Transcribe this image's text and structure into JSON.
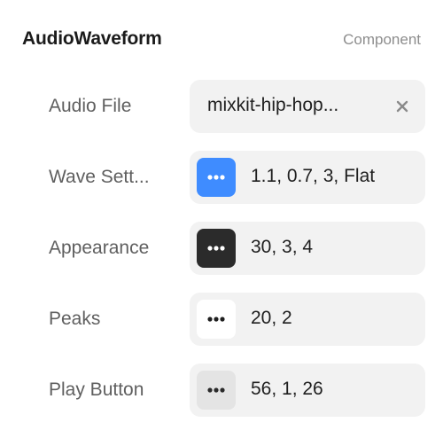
{
  "component": {
    "title": "AudioWaveform",
    "kind_label": "Component"
  },
  "properties": [
    {
      "label": "Audio File",
      "value": "mixkit-hip-hop...",
      "icon": "clear-icon"
    },
    {
      "label": "Wave Sett...",
      "value": "1.1, 0.7, 3, Flat",
      "icon": "more-dots-icon",
      "swatch_color": "#3f8cff"
    },
    {
      "label": "Appearance",
      "value": "30, 3, 4",
      "icon": "more-dots-icon",
      "swatch_color": "#2b2b2b"
    },
    {
      "label": "Peaks",
      "value": "20, 2",
      "icon": "more-dots-icon",
      "swatch_color": "#ffffff"
    },
    {
      "label": "Play Button",
      "value": "56, 1, 26",
      "icon": "more-dots-icon",
      "swatch_color": "#e4e4e4"
    }
  ]
}
